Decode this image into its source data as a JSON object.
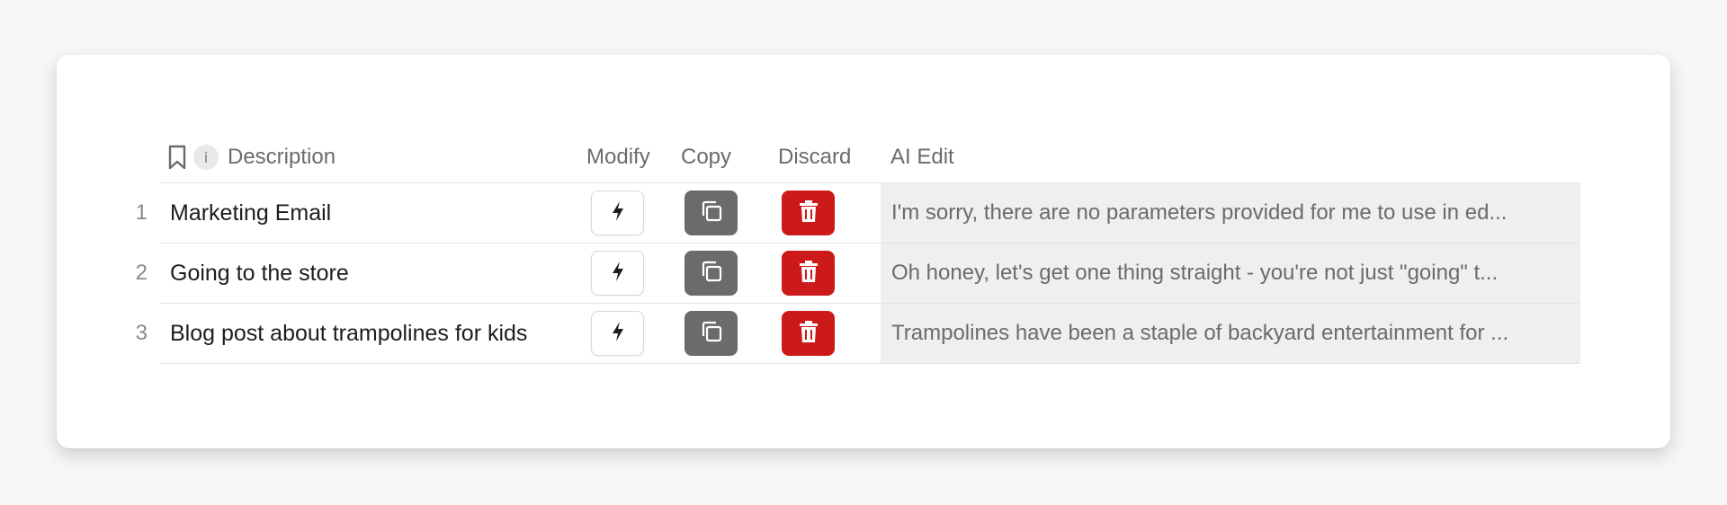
{
  "table": {
    "columns": {
      "description": "Description",
      "modify": "Modify",
      "copy": "Copy",
      "discard": "Discard",
      "ai_edit": "AI Edit"
    },
    "info_badge": "i",
    "rows": [
      {
        "num": "1",
        "description": "Marketing Email",
        "ai_edit": "I'm sorry, there are no parameters provided for me to use in ed..."
      },
      {
        "num": "2",
        "description": "Going to the store",
        "ai_edit": "Oh honey, let's get one thing straight - you're not just \"going\" t..."
      },
      {
        "num": "3",
        "description": "Blog post about trampolines for kids",
        "ai_edit": "Trampolines have been a staple of backyard entertainment for ..."
      }
    ]
  },
  "icons": {
    "header_bookmark": "bookmark-icon",
    "header_info": "info-icon",
    "modify": "lightning-bolt-icon",
    "copy": "copy-icon",
    "discard": "trash-icon"
  },
  "colors": {
    "copy_button": "#6b6b6b",
    "discard_button": "#cc1a1a",
    "ai_edit_background": "#efefef"
  }
}
